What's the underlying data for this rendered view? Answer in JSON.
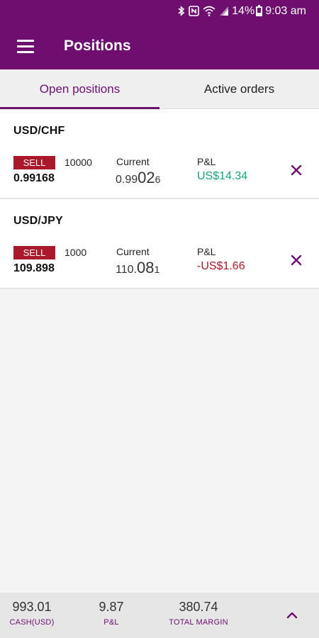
{
  "status_bar": {
    "icons": [
      "bluetooth-icon",
      "nfc-icon",
      "wifi-icon",
      "signal-icon"
    ],
    "battery": "14%",
    "time": "9:03 am"
  },
  "app_bar": {
    "title": "Positions",
    "menu_icon": "hamburger-icon"
  },
  "tabs": [
    {
      "label": "Open positions",
      "active": true
    },
    {
      "label": "Active orders",
      "active": false
    }
  ],
  "positions": [
    {
      "pair": "USD/CHF",
      "side": "SELL",
      "quantity": "10000",
      "entry_price": "0.99168",
      "current_label": "Current",
      "current_a": "0.99",
      "current_b": "02",
      "current_c": "6",
      "pl_label": "P&L",
      "pl_value": "US$14.34",
      "pl_color": "#16a179"
    },
    {
      "pair": "USD/JPY",
      "side": "SELL",
      "quantity": "1000",
      "entry_price": "109.898",
      "current_label": "Current",
      "current_a": "110.",
      "current_b": "08",
      "current_c": "1",
      "pl_label": "P&L",
      "pl_value": "-US$1.66",
      "pl_color": "#a9192b"
    }
  ],
  "summary": {
    "cash_value": "993.01",
    "cash_label": "CASH(USD)",
    "pl_value": "9.87",
    "pl_label": "P&L",
    "margin_value": "380.74",
    "margin_label": "TOTAL MARGIN"
  },
  "colors": {
    "brand": "#6e0f6f",
    "sell": "#a9192b",
    "profit": "#16a179",
    "loss": "#a9192b"
  }
}
